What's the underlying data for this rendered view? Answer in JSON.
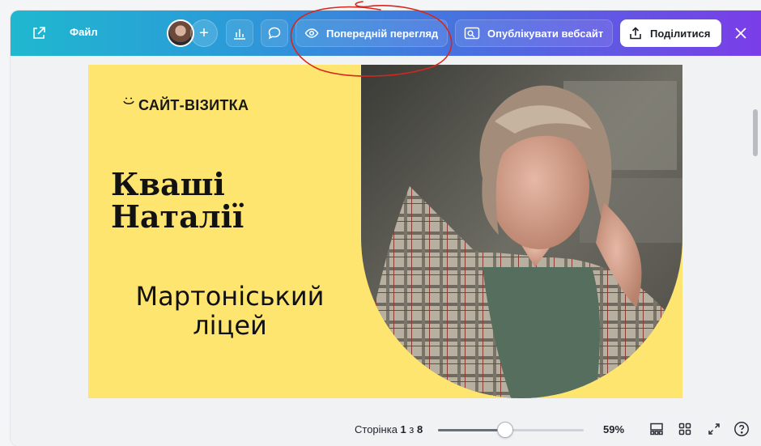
{
  "topbar": {
    "file_label": "Файл",
    "preview_label": "Попередній перегляд",
    "publish_label": "Опублікувати вебсайт",
    "share_label": "Поділитися",
    "icons": [
      "external-link-icon",
      "avatar",
      "plus-icon",
      "chart-icon",
      "comment-icon",
      "eye-icon",
      "publish-icon",
      "share-icon",
      "close-icon"
    ]
  },
  "slide": {
    "logo_text": "САЙТ-ВІЗИТКА",
    "name_line1": "Кваші",
    "name_line2": "Наталії",
    "school_line1": "Мартоніський",
    "school_line2": "ліцей",
    "background_color": "#fee56f"
  },
  "bottombar": {
    "page_prefix": "Сторінка ",
    "page_current": "1",
    "page_sep": " з ",
    "page_total": "8",
    "zoom_label": "59%",
    "zoom_value": 0.59
  },
  "colors": {
    "accent_start": "#1fb8cf",
    "accent_end": "#7b3de8",
    "annotation": "#d9261c"
  }
}
